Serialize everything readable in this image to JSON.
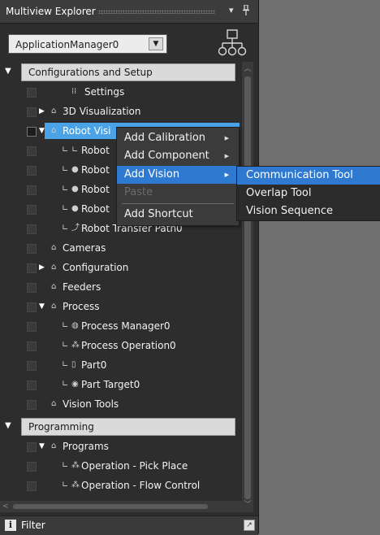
{
  "panel": {
    "title": "Multiview Explorer",
    "pin_glyph": "▾",
    "pin_glyph2": "❙"
  },
  "manager_select": {
    "value": "ApplicationManager0",
    "icon": "hierarchy-icon"
  },
  "tree": {
    "configurations_group": "Configurations and Setup",
    "settings": "Settings",
    "visualization": "3D Visualization",
    "robot_vision": "Robot Visi",
    "robot_1": "Robot",
    "robot_2": "Robot",
    "robot_3": "Robot",
    "robot_4": "Robot",
    "robot_transfer": "Robot Transfer Path0",
    "cameras": "Cameras",
    "configuration": "Configuration",
    "feeders": "Feeders",
    "process": "Process",
    "process_manager": "Process Manager0",
    "process_operation": "Process Operation0",
    "part": "Part0",
    "part_target": "Part Target0",
    "vision_tools": "Vision Tools",
    "programming_group": "Programming",
    "programs": "Programs",
    "op_pick_place": "Operation - Pick Place",
    "op_flow_control": "Operation - Flow Control"
  },
  "context_menu": {
    "add_calibration": "Add Calibration",
    "add_component": "Add Component",
    "add_vision": "Add Vision",
    "paste": "Paste",
    "add_shortcut": "Add Shortcut"
  },
  "submenu": {
    "communication_tool": "Communication Tool",
    "overlap_tool": "Overlap Tool",
    "vision_sequence": "Vision Sequence"
  },
  "filter": {
    "label": "Filter",
    "info_glyph": "i"
  },
  "colors": {
    "selection": "#4aa3e6",
    "menu_highlight": "#2f7ad0"
  }
}
